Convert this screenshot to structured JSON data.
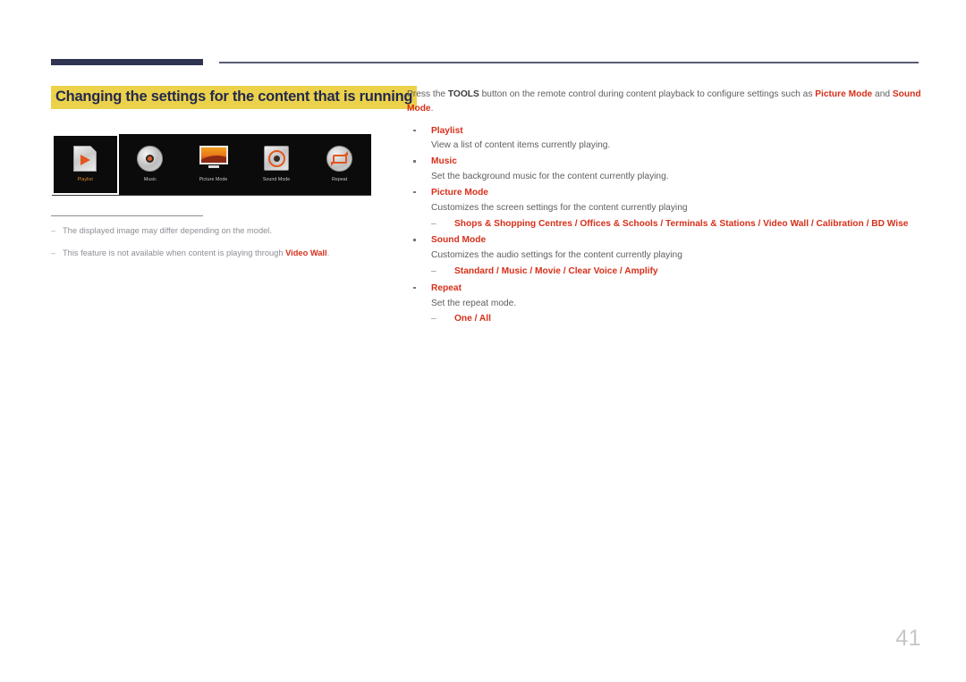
{
  "page": {
    "number": "41"
  },
  "left": {
    "section_title": "Changing the settings for the content that is running",
    "osd": {
      "items": [
        {
          "label": "Playlist",
          "icon": "playlist-document-icon",
          "selected": true
        },
        {
          "label": "Music",
          "icon": "music-disc-icon",
          "selected": false
        },
        {
          "label": "Picture Mode",
          "icon": "monitor-picture-icon",
          "selected": false
        },
        {
          "label": "Sound Mode",
          "icon": "speaker-sound-icon",
          "selected": false
        },
        {
          "label": "Repeat",
          "icon": "repeat-loop-icon",
          "selected": false
        }
      ]
    },
    "notes": [
      {
        "dash": "–",
        "text_before": "The displayed image may differ depending on the model.",
        "highlight": "",
        "text_after": ""
      },
      {
        "dash": "–",
        "text_before": "This feature is not available when content is playing through ",
        "highlight": "Video Wall",
        "text_after": "."
      }
    ]
  },
  "right": {
    "intro": {
      "p1": "Press the ",
      "tools": "TOOLS",
      "p2": " button on the remote control during content playback to configure settings such as ",
      "picture_mode": "Picture Mode",
      "p3": " and ",
      "sound_mode": "Sound Mode",
      "p4": "."
    },
    "items": [
      {
        "title": "Playlist",
        "desc": "View a list of content items currently playing.",
        "options": ""
      },
      {
        "title": "Music",
        "desc": "Set the background music for the content currently playing.",
        "options": ""
      },
      {
        "title": "Picture Mode",
        "desc": "Customizes the screen settings for the content currently playing",
        "options": "Shops & Shopping Centres / Offices & Schools / Terminals & Stations / Video Wall / Calibration / BD Wise"
      },
      {
        "title": "Sound Mode",
        "desc": "Customizes the audio settings for the content currently playing",
        "options": "Standard / Music / Movie / Clear Voice / Amplify"
      },
      {
        "title": "Repeat",
        "desc": "Set the repeat mode.",
        "options": "One / All"
      }
    ],
    "dash_marker": "–"
  },
  "colors": {
    "accent_red": "#d6301a",
    "highlight_yellow": "#ecd24b",
    "title_navy": "#23294d",
    "rule_navy": "#2e3352"
  }
}
